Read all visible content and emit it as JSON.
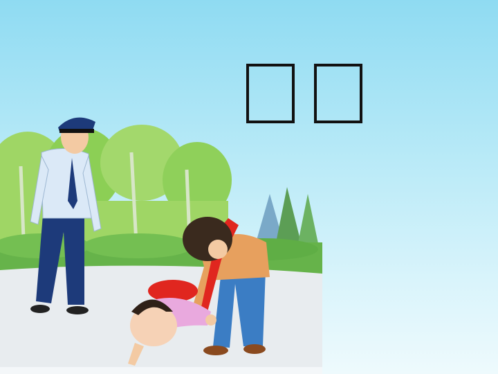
{
  "slide": {
    "title_chars": [
      "",
      ""
    ]
  },
  "illustration": {
    "description_icons": [
      "police-officer",
      "boy-with-red-scarf",
      "fallen-child",
      "trees"
    ],
    "colors": {
      "sky": "#8fdbf2",
      "tree_green": "#7cc34a",
      "ground": "#e7ebee",
      "uniform_shirt": "#dbe9f7",
      "uniform_pants": "#1d3a7a",
      "scarf_red": "#e0261f"
    }
  }
}
